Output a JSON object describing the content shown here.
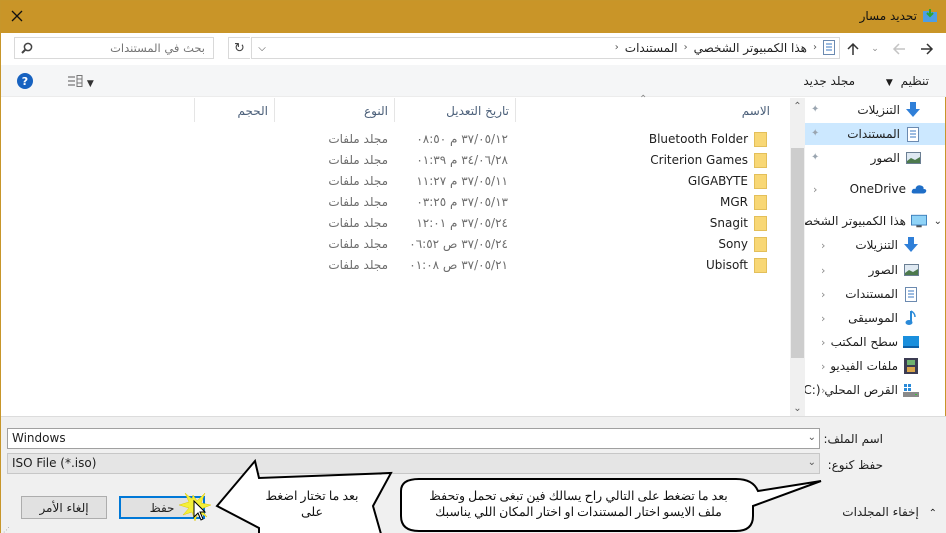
{
  "window": {
    "title": "تحديد مسار",
    "close_label": "✕"
  },
  "address": {
    "breadcrumbs": [
      "هذا الكمبيوتر الشخصي",
      "المستندات"
    ],
    "search_placeholder": "بحث في المستندات",
    "refresh_label": "↻"
  },
  "toolbar": {
    "organize_label": "تنظيم",
    "new_folder_label": "مجلد جديد",
    "help_label": "?"
  },
  "columns": {
    "name": "الاسم",
    "date": "تاريخ التعديل",
    "type": "النوع",
    "size": "الحجم"
  },
  "files": [
    {
      "name": "Bluetooth Folder",
      "date": "٣٧/٠٥/١٢ م ٠٨:٥٠",
      "type": "مجلد ملفات",
      "icon": "folder-icon"
    },
    {
      "name": "Criterion Games",
      "date": "٣٤/٠٦/٢٨ م ٠١:٣٩",
      "type": "مجلد ملفات",
      "icon": "folder-icon"
    },
    {
      "name": "GIGABYTE",
      "date": "٣٧/٠٥/١١ م ١١:٢٧",
      "type": "مجلد ملفات",
      "icon": "folder-icon"
    },
    {
      "name": "MGR",
      "date": "٣٧/٠٥/١٣ م ٠٣:٢٥",
      "type": "مجلد ملفات",
      "icon": "folder-icon"
    },
    {
      "name": "Snagit",
      "date": "٣٧/٠٥/٢٤ م ١٢:٠١",
      "type": "مجلد ملفات",
      "icon": "folder-icon"
    },
    {
      "name": "Sony",
      "date": "٣٧/٠٥/٢٤ ص ٠٦:٥٢",
      "type": "مجلد ملفات",
      "icon": "folder-icon"
    },
    {
      "name": "Ubisoft",
      "date": "٣٧/٠٥/٢١ ص ٠١:٠٨",
      "type": "مجلد ملفات",
      "icon": "folder-icon"
    }
  ],
  "nav": {
    "quick_access": [
      {
        "label": "التنزيلات",
        "icon": "download-arrow-icon",
        "pinned": true
      },
      {
        "label": "المستندات",
        "icon": "documents-icon",
        "pinned": true,
        "selected": true
      },
      {
        "label": "الصور",
        "icon": "pictures-icon",
        "pinned": true
      }
    ],
    "onedrive": {
      "label": "OneDrive",
      "icon": "cloud-icon"
    },
    "this_pc": {
      "label": "هذا الكمبيوتر الشخصي",
      "icon": "monitor-icon"
    },
    "this_pc_children": [
      {
        "label": "التنزيلات",
        "icon": "download-arrow-icon"
      },
      {
        "label": "الصور",
        "icon": "pictures-icon"
      },
      {
        "label": "المستندات",
        "icon": "documents-icon"
      },
      {
        "label": "الموسيقى",
        "icon": "music-note-icon"
      },
      {
        "label": "سطح المكتب",
        "icon": "desktop-icon"
      },
      {
        "label": "ملفات الفيديو",
        "icon": "video-film-icon"
      },
      {
        "label": "القرص المحلي (:C",
        "icon": "drive-icon"
      }
    ]
  },
  "form": {
    "filename_label": "اسم الملف:",
    "filename_value": "Windows",
    "savetype_label": "حفظ كنوع:",
    "savetype_value": "ISO File (*.iso)"
  },
  "buttons": {
    "save": "حفظ",
    "cancel": "إلغاء الأمر",
    "hide_folders": "إخفاء المجلدات"
  },
  "annotations": {
    "arrow_callout": [
      "بعد ما تختار اضغط",
      "على"
    ],
    "speech_callout": [
      "بعد ما تضغط على التالي راح يسالك فين تبغى تحمل وتحفظ",
      "ملف الايسو اختار المستندات او اختار المكان اللي يناسبك"
    ]
  }
}
